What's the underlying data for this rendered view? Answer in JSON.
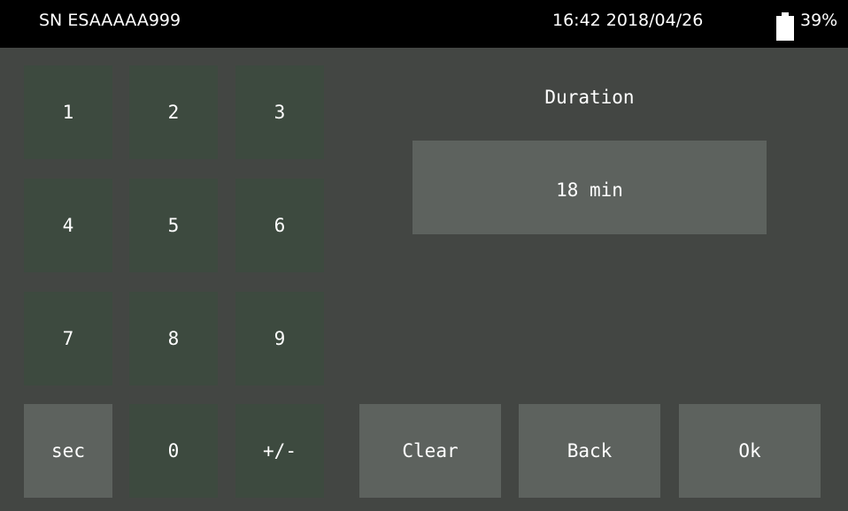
{
  "status_bar": {
    "serial": "SN ESAAAAA999",
    "datetime": "16:42 2018/04/26",
    "battery_percent": "39%",
    "battery_level": 0.39
  },
  "field": {
    "title": "Duration",
    "value": "18 min"
  },
  "keypad": {
    "k1": "1",
    "k2": "2",
    "k3": "3",
    "k4": "4",
    "k5": "5",
    "k6": "6",
    "k7": "7",
    "k8": "8",
    "k9": "9",
    "unit": "sec",
    "k0": "0",
    "sign": "+/-"
  },
  "actions": {
    "clear": "Clear",
    "back": "Back",
    "ok": "Ok"
  },
  "colors": {
    "background": "#434643",
    "status_bar": "#000000",
    "digit_key": "#3d4a3f",
    "action_key": "#5d625e",
    "text": "#ffffff"
  }
}
